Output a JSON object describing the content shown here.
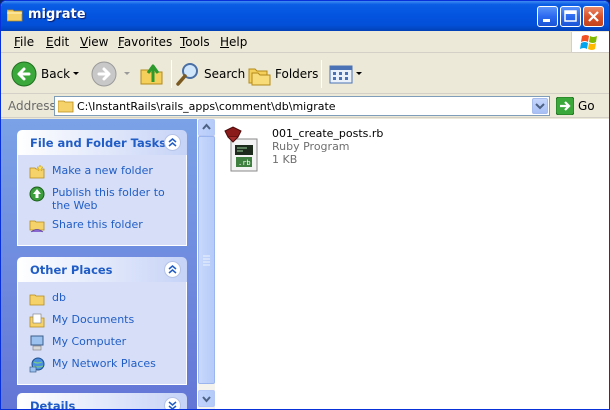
{
  "window": {
    "title": "migrate"
  },
  "menubar": {
    "items": [
      "File",
      "Edit",
      "View",
      "Favorites",
      "Tools",
      "Help"
    ]
  },
  "toolbar": {
    "back_label": "Back",
    "search_label": "Search",
    "folders_label": "Folders"
  },
  "address": {
    "label": "Address",
    "value": "C:\\InstantRails\\rails_apps\\comment\\db\\migrate",
    "go_label": "Go"
  },
  "sidebar": {
    "file_tasks": {
      "title": "File and Folder Tasks",
      "items": [
        {
          "label": "Make a new folder",
          "icon": "new-folder-icon"
        },
        {
          "label": "Publish this folder to the Web",
          "icon": "publish-web-icon"
        },
        {
          "label": "Share this folder",
          "icon": "share-folder-icon"
        }
      ]
    },
    "other_places": {
      "title": "Other Places",
      "items": [
        {
          "label": "db",
          "icon": "folder-icon"
        },
        {
          "label": "My Documents",
          "icon": "my-documents-icon"
        },
        {
          "label": "My Computer",
          "icon": "my-computer-icon"
        },
        {
          "label": "My Network Places",
          "icon": "network-places-icon"
        }
      ]
    },
    "details": {
      "title": "Details"
    }
  },
  "files": [
    {
      "name": "001_create_posts.rb",
      "type": "Ruby Program",
      "size": "1 KB",
      "icon": "ruby-file-icon"
    }
  ],
  "colors": {
    "titlebar": "#0454e0",
    "task_link": "#215dc6",
    "sidebar_bg": "#7ba2e7"
  }
}
